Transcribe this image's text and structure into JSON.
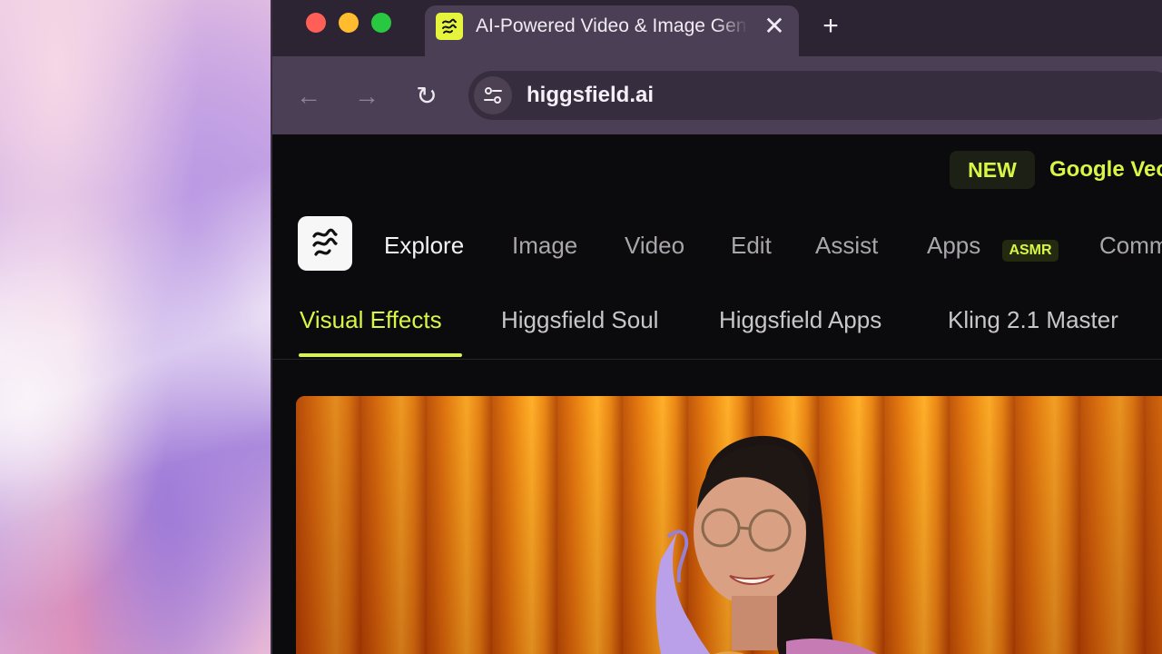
{
  "browser": {
    "tab": {
      "title": "AI-Powered Video & Image Generator",
      "close_glyph": "✕",
      "favicon": "higgsfield-logo-icon"
    },
    "new_tab_glyph": "+",
    "nav": {
      "back_glyph": "←",
      "forward_glyph": "→",
      "reload_glyph": "↻"
    },
    "address": {
      "url": "higgsfield.ai",
      "site_info_icon": "tune-icon"
    }
  },
  "page": {
    "promo": {
      "badge": "NEW",
      "text": "Google Veo"
    },
    "main_nav": {
      "items": [
        {
          "label": "Explore",
          "active": true
        },
        {
          "label": "Image"
        },
        {
          "label": "Video"
        },
        {
          "label": "Edit"
        },
        {
          "label": "Assist"
        },
        {
          "label": "Apps",
          "badge": "ASMR"
        },
        {
          "label": "Comm"
        }
      ]
    },
    "sub_nav": {
      "items": [
        {
          "label": "Visual Effects",
          "active": true
        },
        {
          "label": "Higgsfield Soul"
        },
        {
          "label": "Higgsfield Apps"
        },
        {
          "label": "Kling 2.1 Master"
        }
      ]
    }
  },
  "colors": {
    "accent": "#d9f545",
    "page_bg": "#0b0a0c",
    "chrome_bg": "#4a3f54"
  }
}
